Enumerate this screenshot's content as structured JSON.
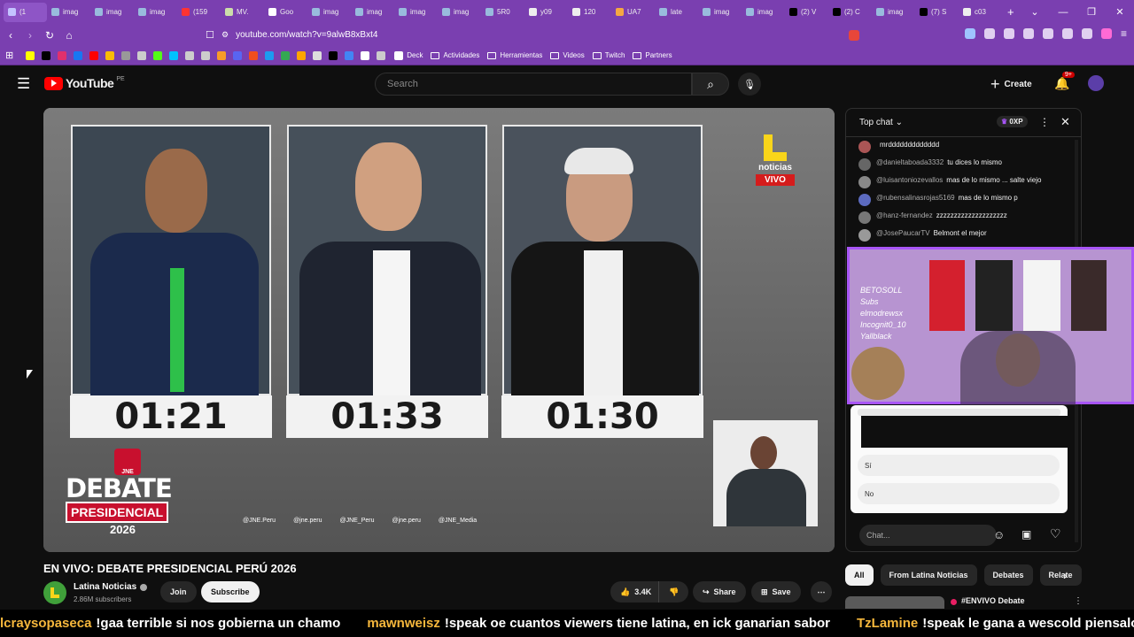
{
  "browser": {
    "tabs": [
      {
        "label": "(1",
        "color": "#c3c3ff"
      },
      {
        "label": "imag",
        "color": "#9bd"
      },
      {
        "label": "imag",
        "color": "#9bd"
      },
      {
        "label": "imag",
        "color": "#9bd"
      },
      {
        "label": "(159",
        "color": "#ff3333"
      },
      {
        "label": "MV.",
        "color": "#cda"
      },
      {
        "label": "Goo",
        "color": "#fff"
      },
      {
        "label": "imag",
        "color": "#9bd"
      },
      {
        "label": "imag",
        "color": "#9bd"
      },
      {
        "label": "imag",
        "color": "#9bd"
      },
      {
        "label": "imag",
        "color": "#9bd"
      },
      {
        "label": "5R0",
        "color": "#9bd"
      },
      {
        "label": "y09",
        "color": "#eee"
      },
      {
        "label": "120",
        "color": "#eee"
      },
      {
        "label": "UA7",
        "color": "#f5a742"
      },
      {
        "label": "late",
        "color": "#9bd"
      },
      {
        "label": "imag",
        "color": "#9bd"
      },
      {
        "label": "imag",
        "color": "#9bd"
      },
      {
        "label": "(2) V",
        "color": "#000"
      },
      {
        "label": "(2) C",
        "color": "#000"
      },
      {
        "label": "imag",
        "color": "#9bd"
      },
      {
        "label": "(7) S",
        "color": "#000"
      },
      {
        "label": "c03",
        "color": "#eee"
      }
    ],
    "url": "youtube.com/watch?v=9alwB8xBxt4",
    "bookmarks": [
      "Deck",
      "Actividades",
      "Herramientas",
      "Videos",
      "Twitch",
      "Partners"
    ]
  },
  "youtube": {
    "logo_text": "YouTube",
    "region": "PE",
    "search_placeholder": "Search",
    "create_label": "Create",
    "notif_badge": "9+"
  },
  "video": {
    "timers": [
      "01:21",
      "01:33",
      "01:30"
    ],
    "channel_logo_text": "noticias",
    "live_badge": "VIVO",
    "jne_label": "JNE",
    "debate_title": "DEBATE",
    "debate_subtitle": "PRESIDENCIAL",
    "debate_year": "2026",
    "socials": [
      "@JNE.Peru",
      "@jne.peru",
      "@JNE_Peru",
      "@jne.peru",
      "@JNE_Media"
    ]
  },
  "info": {
    "title": "EN VIVO: DEBATE PRESIDENCIAL PERÚ 2026",
    "channel": "Latina Noticias",
    "subscribers": "2.86M subscribers",
    "join": "Join",
    "subscribe": "Subscribe",
    "likes": "3.4K",
    "share": "Share",
    "save": "Save"
  },
  "chat": {
    "header": "Top chat",
    "points": "0XP",
    "messages": [
      {
        "author": "",
        "text": "mrddddddddddddd",
        "color": "#aa5555"
      },
      {
        "author": "@danieltaboada3332",
        "text": "tu dices lo mismo",
        "color": "#666"
      },
      {
        "author": "@luisantoniozevallos",
        "text": "mas de lo mismo ... salte viejo",
        "color": "#888"
      },
      {
        "author": "@rubensalinasrojas5169",
        "text": "mas de lo mismo p",
        "color": "#5c6bc0"
      },
      {
        "author": "@hanz-fernandez",
        "text": "zzzzzzzzzzzzzzzzzzzz",
        "color": "#777"
      },
      {
        "author": "@JosePaucarTV",
        "text": "Belmont el mejor",
        "color": "#999"
      }
    ],
    "overlay_labels": [
      "BETOSOLL",
      "Subs",
      "elmodrewsx",
      "Incognit0_10",
      "Yallblack"
    ],
    "poll_options": [
      "Sí",
      "No"
    ],
    "input_placeholder": "Chat..."
  },
  "chips": [
    "All",
    "From Latina Noticias",
    "Debates",
    "Relate"
  ],
  "next_video": "#ENVIVO Debate",
  "ticker": [
    {
      "name": "lcraysopaseca",
      "text": "!gaa terrible si nos gobierna un chamo"
    },
    {
      "name": "mawnweisz",
      "text": "!speak oe cuantos viewers tiene latina, en ick ganarian sabor"
    },
    {
      "name": "TzLamine",
      "text": "!speak le gana a wescold piensalo"
    }
  ]
}
